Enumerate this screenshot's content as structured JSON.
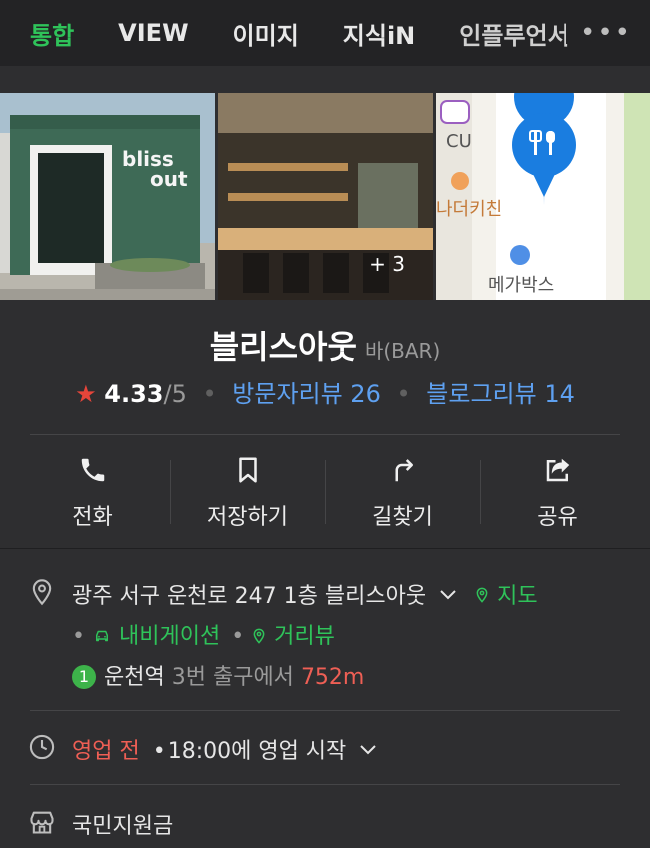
{
  "tabs": [
    {
      "label": "통합"
    },
    {
      "label": "VIEW"
    },
    {
      "label": "이미지"
    },
    {
      "label": "지식iN"
    },
    {
      "label": "인플루언서"
    }
  ],
  "more_label": "•••",
  "photos": {
    "sign_line1": "bliss",
    "sign_line2": "out",
    "more_count": "+ 3",
    "map_labels": [
      "CU",
      "나더키친",
      "메가박스"
    ]
  },
  "place": {
    "name": "블리스아웃",
    "category": "바(BAR)",
    "rating_star": "★",
    "rating": "4.33",
    "rating_max": "/5",
    "visitor_reviews": "방문자리뷰 26",
    "blog_reviews": "블로그리뷰 14"
  },
  "actions": [
    {
      "label": "전화",
      "icon": "phone-icon"
    },
    {
      "label": "저장하기",
      "icon": "bookmark-icon"
    },
    {
      "label": "길찾기",
      "icon": "directions-icon"
    },
    {
      "label": "공유",
      "icon": "share-icon"
    }
  ],
  "address": {
    "text": "광주 서구 운천로 247 1층 블리스아웃",
    "map_link": "지도",
    "navigation_link": "내비게이션",
    "street_view_link": "거리뷰"
  },
  "subway": {
    "line": "1",
    "station": "운천역",
    "exit": "3번 출구에서",
    "distance": "752m"
  },
  "hours": {
    "status": "영업 전",
    "detail": "18:00에 영업 시작"
  },
  "support": {
    "label": "국민지원금"
  },
  "colors": {
    "accent_green": "#2fc35a",
    "link_blue": "#5ea0f0",
    "status_red": "#ef5f55",
    "star_red": "#e6453a",
    "background": "#2e2e30"
  }
}
